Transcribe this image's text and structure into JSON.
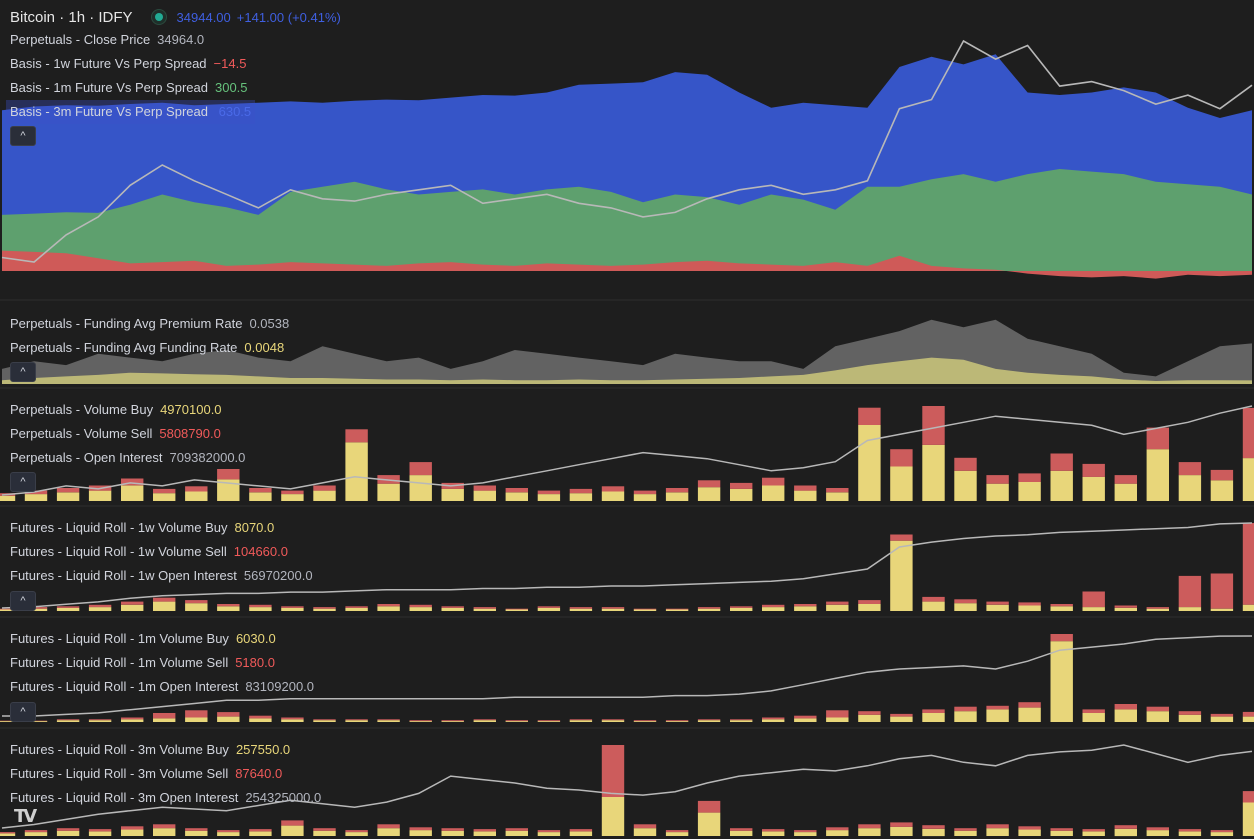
{
  "header": {
    "symbol": "Bitcoin · 1h · IDFY",
    "price": "34944.00",
    "change": "+141.00 (+0.41%)"
  },
  "colors": {
    "background": "#1e1e1e",
    "blue": "#3655c8",
    "green": "#5ea06e",
    "red": "#cf5a58",
    "gray_area": "#6e6e6e",
    "bar_yellow": "#e8d67a",
    "bar_red": "#cc5c5c",
    "line_gray": "#b8b8b8",
    "olive": "#c7c27a"
  },
  "panes": [
    {
      "id": "basis",
      "legend": [
        {
          "label": "Perpetuals - Close Price",
          "value": "34964.0",
          "color": "#b2b5be"
        },
        {
          "label": "Basis - 1w Future Vs Perp Spread",
          "value": "−14.5",
          "color": "#f05a5a"
        },
        {
          "label": "Basis - 1m Future Vs Perp Spread",
          "value": "300.5",
          "color": "#66c17c"
        },
        {
          "label": "Basis - 3m Future Vs Perp Spread",
          "value": "630.5",
          "color": "#4a6ae8"
        }
      ]
    },
    {
      "id": "funding",
      "legend": [
        {
          "label": "Perpetuals - Funding Avg Premium Rate",
          "value": "0.0538",
          "color": "#b2b5be"
        },
        {
          "label": "Perpetuals - Funding Avg Funding Rate",
          "value": "0.0048",
          "color": "#e8d67a"
        }
      ]
    },
    {
      "id": "perp_volume",
      "legend": [
        {
          "label": "Perpetuals - Volume Buy",
          "value": "4970100.0",
          "color": "#e8d67a"
        },
        {
          "label": "Perpetuals - Volume Sell",
          "value": "5808790.0",
          "color": "#f05a5a"
        },
        {
          "label": "Perpetuals - Open Interest",
          "value": "709382000.0",
          "color": "#b2b5be"
        }
      ]
    },
    {
      "id": "roll_1w",
      "legend": [
        {
          "label": "Futures - Liquid Roll - 1w Volume Buy",
          "value": "8070.0",
          "color": "#e8d67a"
        },
        {
          "label": "Futures - Liquid Roll - 1w Volume Sell",
          "value": "104660.0",
          "color": "#f05a5a"
        },
        {
          "label": "Futures - Liquid Roll - 1w Open Interest",
          "value": "56970200.0",
          "color": "#b2b5be"
        }
      ]
    },
    {
      "id": "roll_1m",
      "legend": [
        {
          "label": "Futures - Liquid Roll - 1m Volume Buy",
          "value": "6030.0",
          "color": "#e8d67a"
        },
        {
          "label": "Futures - Liquid Roll - 1m Volume Sell",
          "value": "5180.0",
          "color": "#f05a5a"
        },
        {
          "label": "Futures - Liquid Roll - 1m Open Interest",
          "value": "83109200.0",
          "color": "#b2b5be"
        }
      ]
    },
    {
      "id": "roll_3m",
      "legend": [
        {
          "label": "Futures - Liquid Roll - 3m Volume Buy",
          "value": "257550.0",
          "color": "#e8d67a"
        },
        {
          "label": "Futures - Liquid Roll - 3m Volume Sell",
          "value": "87640.0",
          "color": "#f05a5a"
        },
        {
          "label": "Futures - Liquid Roll - 3m Open Interest",
          "value": "254325000.0",
          "color": "#b2b5be"
        }
      ]
    }
  ],
  "logo": "TV",
  "collapse_glyph": "^",
  "chart_data": [
    {
      "type": "area",
      "pane": "basis",
      "series": [
        {
          "name": "Basis - 3m Future Vs Perp Spread",
          "color": "#3655c8",
          "values": [
            630,
            645,
            650,
            648,
            655,
            660,
            650,
            655,
            660,
            665,
            660,
            668,
            672,
            670,
            680,
            690,
            688,
            700,
            730,
            735,
            740,
            780,
            770,
            700,
            640,
            660,
            650,
            640,
            800,
            840,
            810,
            850,
            700,
            690,
            700,
            720,
            700,
            640,
            600,
            630
          ]
        },
        {
          "name": "Basis - 1m Future Vs Perp Spread",
          "color": "#5ea06e",
          "values": [
            220,
            225,
            230,
            228,
            260,
            300,
            270,
            250,
            220,
            310,
            330,
            350,
            320,
            300,
            310,
            320,
            300,
            320,
            330,
            310,
            270,
            300,
            290,
            260,
            300,
            280,
            240,
            330,
            330,
            360,
            380,
            350,
            380,
            400,
            390,
            380,
            350,
            340,
            330,
            300
          ]
        },
        {
          "name": "Basis - 1w Future Vs Perp Spread",
          "color": "#cf5a58",
          "values": [
            80,
            75,
            70,
            50,
            30,
            35,
            40,
            20,
            25,
            35,
            30,
            25,
            20,
            30,
            35,
            25,
            20,
            30,
            25,
            20,
            25,
            35,
            40,
            30,
            25,
            20,
            35,
            20,
            60,
            20,
            10,
            5,
            -10,
            -20,
            -25,
            -20,
            -30,
            -15,
            -20,
            -15
          ]
        },
        {
          "name": "Perpetuals - Close Price",
          "color": "#b8b8b8",
          "values": [
            34200,
            34180,
            34300,
            34380,
            34520,
            34610,
            34540,
            34480,
            34420,
            34500,
            34460,
            34450,
            34480,
            34500,
            34520,
            34440,
            34460,
            34480,
            34440,
            34420,
            34380,
            34400,
            34460,
            34500,
            34520,
            34480,
            34500,
            34540,
            34860,
            34900,
            35160,
            35080,
            35140,
            34960,
            34980,
            34940,
            34880,
            34920,
            34860,
            34964
          ]
        }
      ]
    },
    {
      "type": "area",
      "pane": "funding",
      "series": [
        {
          "name": "Perpetuals - Funding Avg Premium Rate",
          "color": "#6e6e6e",
          "values": [
            0.02,
            0.03,
            0.025,
            0.04,
            0.035,
            0.03,
            0.04,
            0.045,
            0.035,
            0.03,
            0.05,
            0.04,
            0.03,
            0.035,
            0.02,
            0.03,
            0.045,
            0.04,
            0.035,
            0.03,
            0.025,
            0.04,
            0.035,
            0.03,
            0.03,
            0.02,
            0.05,
            0.06,
            0.07,
            0.085,
            0.075,
            0.085,
            0.06,
            0.05,
            0.04,
            0.015,
            0.01,
            0.03,
            0.05,
            0.0538
          ]
        },
        {
          "name": "Perpetuals - Funding Avg Funding Rate",
          "color": "#c7c27a",
          "values": [
            0.005,
            0.008,
            0.01,
            0.012,
            0.015,
            0.014,
            0.013,
            0.012,
            0.01,
            0.008,
            0.008,
            0.007,
            0.006,
            0.006,
            0.005,
            0.006,
            0.005,
            0.005,
            0.006,
            0.005,
            0.005,
            0.006,
            0.007,
            0.008,
            0.01,
            0.012,
            0.018,
            0.025,
            0.03,
            0.035,
            0.032,
            0.02,
            0.015,
            0.012,
            0.01,
            0.006,
            0.004,
            0.005,
            0.005,
            0.0048
          ]
        }
      ]
    },
    {
      "type": "bar",
      "pane": "perp_volume",
      "series": [
        {
          "name": "Perpetuals - Volume Buy",
          "color": "#e8d67a",
          "values": [
            0.6,
            0.8,
            1.0,
            1.2,
            1.8,
            0.9,
            1.1,
            2.5,
            1.0,
            0.8,
            1.2,
            6.8,
            2.0,
            3.0,
            1.4,
            1.2,
            1.0,
            0.8,
            0.9,
            1.1,
            0.8,
            1.0,
            1.6,
            1.4,
            1.8,
            1.2,
            1.0,
            8.8,
            4.0,
            6.5,
            3.5,
            2.0,
            2.2,
            3.5,
            2.8,
            2.0,
            6.0,
            3.0,
            2.4,
            4.97
          ]
        },
        {
          "name": "Perpetuals - Volume Sell",
          "color": "#cc5c5c",
          "values": [
            0.3,
            0.4,
            0.5,
            0.6,
            0.8,
            0.5,
            0.6,
            1.2,
            0.5,
            0.4,
            0.6,
            1.5,
            1.0,
            1.5,
            0.7,
            0.6,
            0.5,
            0.4,
            0.5,
            0.6,
            0.4,
            0.5,
            0.8,
            0.7,
            0.9,
            0.6,
            0.5,
            2.0,
            2.0,
            4.5,
            1.5,
            1.0,
            1.0,
            2.0,
            1.5,
            1.0,
            2.5,
            1.5,
            1.2,
            5.81
          ]
        },
        {
          "name": "Perpetuals - Open Interest",
          "color": "#b8b8b8",
          "values": [
            680,
            681,
            683,
            682,
            684,
            683,
            685,
            684,
            683,
            682,
            684,
            686,
            685,
            684,
            683,
            684,
            686,
            688,
            690,
            692,
            694,
            693,
            692,
            690,
            688,
            689,
            691,
            698,
            700,
            702,
            704,
            706,
            705,
            704,
            703,
            700,
            702,
            704,
            707,
            709.382
          ]
        }
      ]
    },
    {
      "type": "bar",
      "pane": "roll_1w",
      "series": [
        {
          "name": "Futures - Liquid Roll - 1w Volume Buy",
          "color": "#e8d67a",
          "values": [
            2,
            3,
            4,
            5,
            8,
            12,
            10,
            6,
            5,
            4,
            3,
            4,
            6,
            5,
            4,
            3,
            2,
            4,
            3,
            3,
            2,
            2,
            3,
            4,
            5,
            6,
            8,
            9,
            90,
            12,
            10,
            8,
            7,
            6,
            5,
            4,
            3,
            5,
            3,
            8.07
          ]
        },
        {
          "name": "Futures - Liquid Roll - 1w Volume Sell",
          "color": "#cc5c5c",
          "values": [
            1,
            2,
            2,
            3,
            4,
            5,
            4,
            3,
            3,
            2,
            2,
            2,
            3,
            3,
            2,
            2,
            1,
            2,
            2,
            2,
            1,
            1,
            2,
            2,
            3,
            3,
            4,
            5,
            8,
            6,
            5,
            4,
            4,
            3,
            20,
            3,
            2,
            40,
            45,
            104.66
          ]
        },
        {
          "name": "Futures - Liquid Roll - 1w Open Interest",
          "color": "#b8b8b8",
          "values": [
            50.0,
            50.1,
            50.3,
            50.5,
            50.8,
            51.0,
            51.1,
            51.2,
            51.2,
            51.3,
            51.3,
            51.4,
            51.5,
            51.5,
            51.5,
            51.6,
            51.6,
            51.7,
            51.7,
            51.8,
            51.8,
            51.9,
            52.0,
            52.1,
            52.2,
            52.4,
            52.8,
            53.2,
            55.0,
            55.4,
            55.7,
            55.9,
            56.0,
            56.2,
            56.3,
            56.4,
            56.5,
            56.6,
            56.9,
            56.97
          ]
        }
      ]
    },
    {
      "type": "bar",
      "pane": "roll_1m",
      "series": [
        {
          "name": "Futures - Liquid Roll - 1m Volume Buy",
          "color": "#e8d67a",
          "values": [
            1,
            1,
            2,
            2,
            3,
            4,
            5,
            6,
            4,
            3,
            2,
            2,
            2,
            1,
            1,
            2,
            1,
            1,
            2,
            2,
            1,
            1,
            2,
            2,
            3,
            4,
            5,
            8,
            6,
            10,
            12,
            14,
            16,
            90,
            10,
            14,
            12,
            8,
            6,
            6.03
          ]
        },
        {
          "name": "Futures - Liquid Roll - 1m Volume Sell",
          "color": "#cc5c5c",
          "values": [
            0.5,
            0.5,
            1,
            1,
            2,
            6,
            8,
            5,
            3,
            2,
            1,
            1,
            1,
            1,
            1,
            1,
            1,
            1,
            1,
            1,
            1,
            1,
            1,
            1,
            2,
            3,
            8,
            4,
            3,
            4,
            5,
            4,
            6,
            8,
            4,
            6,
            5,
            4,
            3,
            5.18
          ]
        },
        {
          "name": "Futures - Liquid Roll - 1m Open Interest",
          "color": "#b8b8b8",
          "values": [
            78.0,
            78.0,
            78.1,
            78.2,
            78.4,
            78.6,
            78.8,
            79.0,
            79.0,
            79.1,
            79.1,
            79.1,
            79.1,
            79.1,
            79.1,
            79.1,
            79.2,
            79.2,
            79.2,
            79.2,
            79.2,
            79.3,
            79.3,
            79.4,
            79.6,
            80.0,
            80.4,
            80.8,
            81.0,
            81.1,
            81.2,
            81.0,
            81.5,
            82.2,
            82.4,
            82.6,
            82.9,
            83.0,
            83.1,
            83.1092
          ]
        }
      ]
    },
    {
      "type": "bar",
      "pane": "roll_3m",
      "series": [
        {
          "name": "Futures - Liquid Roll - 3m Volume Buy",
          "color": "#e8d67a",
          "values": [
            20,
            30,
            40,
            35,
            50,
            60,
            40,
            30,
            35,
            80,
            40,
            30,
            60,
            45,
            40,
            35,
            40,
            30,
            35,
            300,
            60,
            30,
            180,
            40,
            35,
            30,
            45,
            60,
            70,
            55,
            40,
            60,
            50,
            40,
            35,
            55,
            45,
            35,
            30,
            257.55
          ]
        },
        {
          "name": "Futures - Liquid Roll - 3m Volume Sell",
          "color": "#cc5c5c",
          "values": [
            10,
            15,
            20,
            18,
            25,
            30,
            20,
            15,
            18,
            40,
            20,
            15,
            30,
            22,
            20,
            18,
            20,
            15,
            18,
            400,
            30,
            15,
            90,
            20,
            18,
            15,
            22,
            30,
            35,
            28,
            20,
            30,
            25,
            20,
            18,
            28,
            22,
            18,
            15,
            87.64
          ]
        },
        {
          "name": "Futures - Liquid Roll - 3m Open Interest",
          "color": "#b8b8b8",
          "values": [
            210,
            212,
            215,
            218,
            220,
            222,
            221,
            220,
            223,
            226,
            224,
            222,
            225,
            230,
            240,
            238,
            236,
            233,
            232,
            230,
            229,
            231,
            236,
            240,
            242,
            244,
            243,
            246,
            250,
            252,
            248,
            246,
            252,
            254,
            255,
            258,
            253,
            248,
            252,
            254.325
          ]
        }
      ]
    }
  ]
}
